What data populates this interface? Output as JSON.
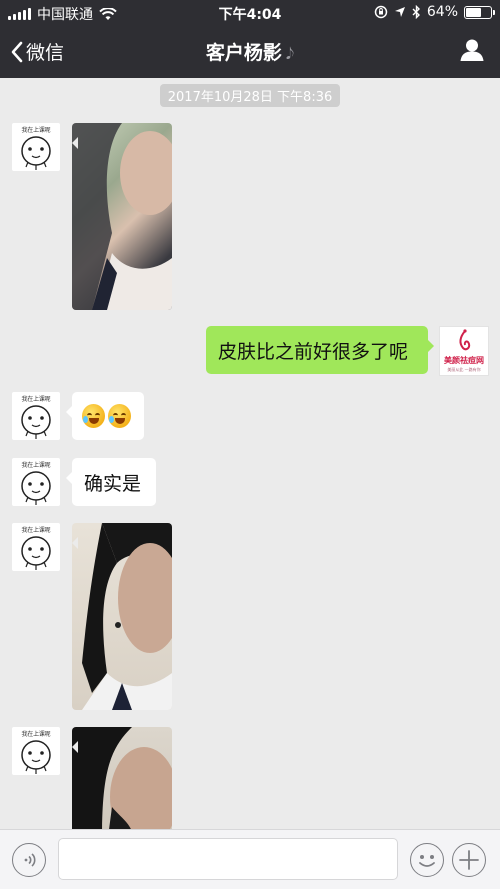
{
  "status_bar": {
    "carrier": "中国联通",
    "time": "下午4:04",
    "battery": "64%",
    "battery_level": 0.64
  },
  "nav": {
    "back_label": "微信",
    "title": "客户杨影"
  },
  "chat": {
    "timestamp": "2017年10月28日 下午8:36",
    "avatar_caption": "我在上课呢",
    "messages": [
      {
        "type": "photo",
        "from": "contact"
      },
      {
        "type": "text",
        "from": "me",
        "text": "皮肤比之前好很多了呢"
      },
      {
        "type": "emoji",
        "from": "contact",
        "emoji": [
          "crying-laughing-emoji",
          "crying-laughing-emoji"
        ]
      },
      {
        "type": "text",
        "from": "contact",
        "text": "确实是"
      },
      {
        "type": "photo",
        "from": "contact"
      },
      {
        "type": "photo",
        "from": "contact"
      }
    ],
    "my_avatar": {
      "brand": "美颜祛痘网",
      "slogan": "美丽从此 一路有你"
    }
  },
  "input_bar": {
    "voice_icon": "voice-icon",
    "emoji_icon": "emoji-icon",
    "plus_icon": "plus-icon",
    "input_value": ""
  }
}
